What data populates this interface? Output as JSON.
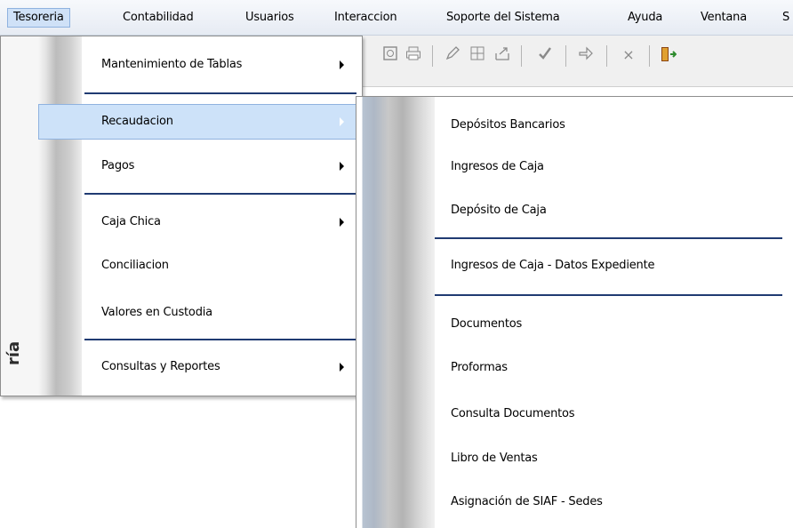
{
  "menubar": {
    "items": [
      {
        "label": "Tesoreria"
      },
      {
        "label": "Contabilidad"
      },
      {
        "label": "Usuarios"
      },
      {
        "label": "Interaccion"
      },
      {
        "label": "Soporte del Sistema"
      },
      {
        "label": "Ayuda"
      },
      {
        "label": "Ventana"
      },
      {
        "label": "S"
      }
    ]
  },
  "toolbar": {
    "icons": [
      "record-icon",
      "print-icon",
      "edit-pen-icon",
      "grid-icon",
      "export-icon",
      "check-icon",
      "redo-icon",
      "delete-x-icon",
      "exit-door-icon"
    ],
    "delete_glyph": "×"
  },
  "side_label": "ría",
  "tesoreria_menu": {
    "items": [
      {
        "label": "Mantenimiento de Tablas"
      },
      {
        "label": "Recaudacion"
      },
      {
        "label": "Pagos"
      },
      {
        "label": "Caja Chica"
      },
      {
        "label": "Conciliacion"
      },
      {
        "label": "Valores en Custodia"
      },
      {
        "label": "Consultas y Reportes"
      }
    ]
  },
  "recaudacion_menu": {
    "items": [
      {
        "label": "Depósitos Bancarios"
      },
      {
        "label": "Ingresos de Caja"
      },
      {
        "label": "Depósito de Caja"
      },
      {
        "label": "Ingresos de Caja - Datos Expediente"
      },
      {
        "label": "Documentos"
      },
      {
        "label": "Proformas"
      },
      {
        "label": "Consulta Documentos"
      },
      {
        "label": "Libro de Ventas"
      },
      {
        "label": "Asignación de SIAF - Sedes"
      }
    ]
  },
  "colors": {
    "highlight": "#cde2f9",
    "highlight_border": "#8fb2df",
    "separator": "#203b72"
  }
}
